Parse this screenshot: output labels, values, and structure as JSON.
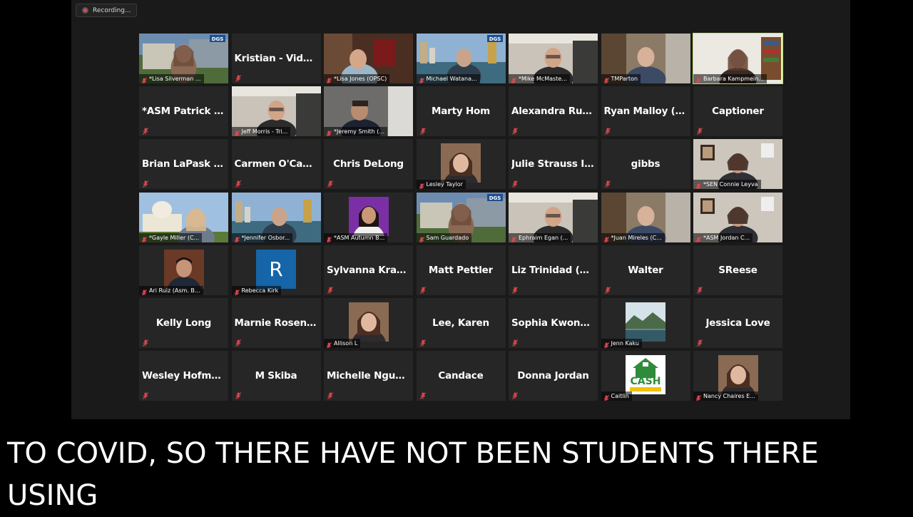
{
  "recording": {
    "label": "Recording..."
  },
  "caption": {
    "text": "TO COVID, SO THERE HAVE NOT BEEN STUDENTS THERE\nUSING"
  },
  "colors": {
    "active_speaker_border": "#b8e45a",
    "tile_bg": "#262626",
    "mute_icon": "#e0484f"
  },
  "participants": [
    {
      "name": "*Lisa Silverman ...",
      "type": "video",
      "scene": "outdoor-building",
      "badge": "DGS"
    },
    {
      "name": "Kristian - Video...",
      "type": "name"
    },
    {
      "name": "*Lisa Jones (OPSC)",
      "type": "video",
      "scene": "office-red"
    },
    {
      "name": "Michael Watana...",
      "type": "video",
      "scene": "city-bridge",
      "badge": "DGS"
    },
    {
      "name": "*Mike McMaste...",
      "type": "video",
      "scene": "office-light"
    },
    {
      "name": "TMParton",
      "type": "video",
      "scene": "kitchen"
    },
    {
      "name": "Barbara Kampmein...",
      "type": "video",
      "scene": "bookshelf",
      "active": true
    },
    {
      "name": "*ASM Patrick O'...",
      "type": "name"
    },
    {
      "name": "Jeff Morris - Tri...",
      "type": "video",
      "scene": "office-light"
    },
    {
      "name": "*Jeremy Smith (...",
      "type": "video",
      "scene": "office-dark"
    },
    {
      "name": "Marty Hom",
      "type": "name"
    },
    {
      "name": "Alexandra Ruilo...",
      "type": "name"
    },
    {
      "name": "Ryan Malloy (O...",
      "type": "name"
    },
    {
      "name": "Captioner",
      "type": "name"
    },
    {
      "name": "Brian LaPask -...",
      "type": "name"
    },
    {
      "name": "Carmen O'Campo",
      "type": "name"
    },
    {
      "name": "Chris DeLong",
      "type": "name"
    },
    {
      "name": "Lesley Taylor",
      "type": "avatar",
      "scene": "portrait-woman"
    },
    {
      "name": "Julie Strauss I H...",
      "type": "name"
    },
    {
      "name": "gibbs",
      "type": "name"
    },
    {
      "name": "*SEN Connie Leyva",
      "type": "video",
      "scene": "office-wall"
    },
    {
      "name": "*Gayle Miller (C...",
      "type": "video",
      "scene": "capitol"
    },
    {
      "name": "*Jennifer Osbor...",
      "type": "video",
      "scene": "city-bridge"
    },
    {
      "name": "*ASM Autumn B...",
      "type": "avatar",
      "scene": "portrait-purple"
    },
    {
      "name": "Sam Guardado",
      "type": "video",
      "scene": "outdoor-building",
      "badge": "DGS"
    },
    {
      "name": "Ephraim Egan (...",
      "type": "video",
      "scene": "office-light"
    },
    {
      "name": "*Juan Mireles (C...",
      "type": "video",
      "scene": "kitchen"
    },
    {
      "name": "*ASM Jordan C...",
      "type": "video",
      "scene": "office-wall"
    },
    {
      "name": "Ari Ruiz (Asm. B...",
      "type": "avatar",
      "scene": "portrait-man"
    },
    {
      "name": "Rebecca Kirk",
      "type": "initial",
      "initial": "R"
    },
    {
      "name": "Sylvanna Krawc...",
      "type": "name"
    },
    {
      "name": "Matt Pettler",
      "type": "name"
    },
    {
      "name": "Liz Trinidad (OP...",
      "type": "name"
    },
    {
      "name": "Walter",
      "type": "name"
    },
    {
      "name": "SReese",
      "type": "name"
    },
    {
      "name": "Kelly Long",
      "type": "name"
    },
    {
      "name": "Marnie Rosenst...",
      "type": "name"
    },
    {
      "name": "Allison L",
      "type": "avatar",
      "scene": "portrait-woman"
    },
    {
      "name": "Lee, Karen",
      "type": "name"
    },
    {
      "name": "Sophia Kwong...",
      "type": "name"
    },
    {
      "name": "Jenn Kaku",
      "type": "avatar",
      "scene": "landscape"
    },
    {
      "name": "Jessica Love",
      "type": "name"
    },
    {
      "name": "Wesley Hofmann",
      "type": "name"
    },
    {
      "name": "M Skiba",
      "type": "name"
    },
    {
      "name": "Michelle Nguyen",
      "type": "name"
    },
    {
      "name": "Candace",
      "type": "name"
    },
    {
      "name": "Donna Jordan",
      "type": "name"
    },
    {
      "name": "Caitlin",
      "type": "avatar",
      "scene": "cash-logo",
      "logo_text": "CASH"
    },
    {
      "name": "Nancy Chaires E...",
      "type": "avatar",
      "scene": "portrait-woman"
    }
  ]
}
